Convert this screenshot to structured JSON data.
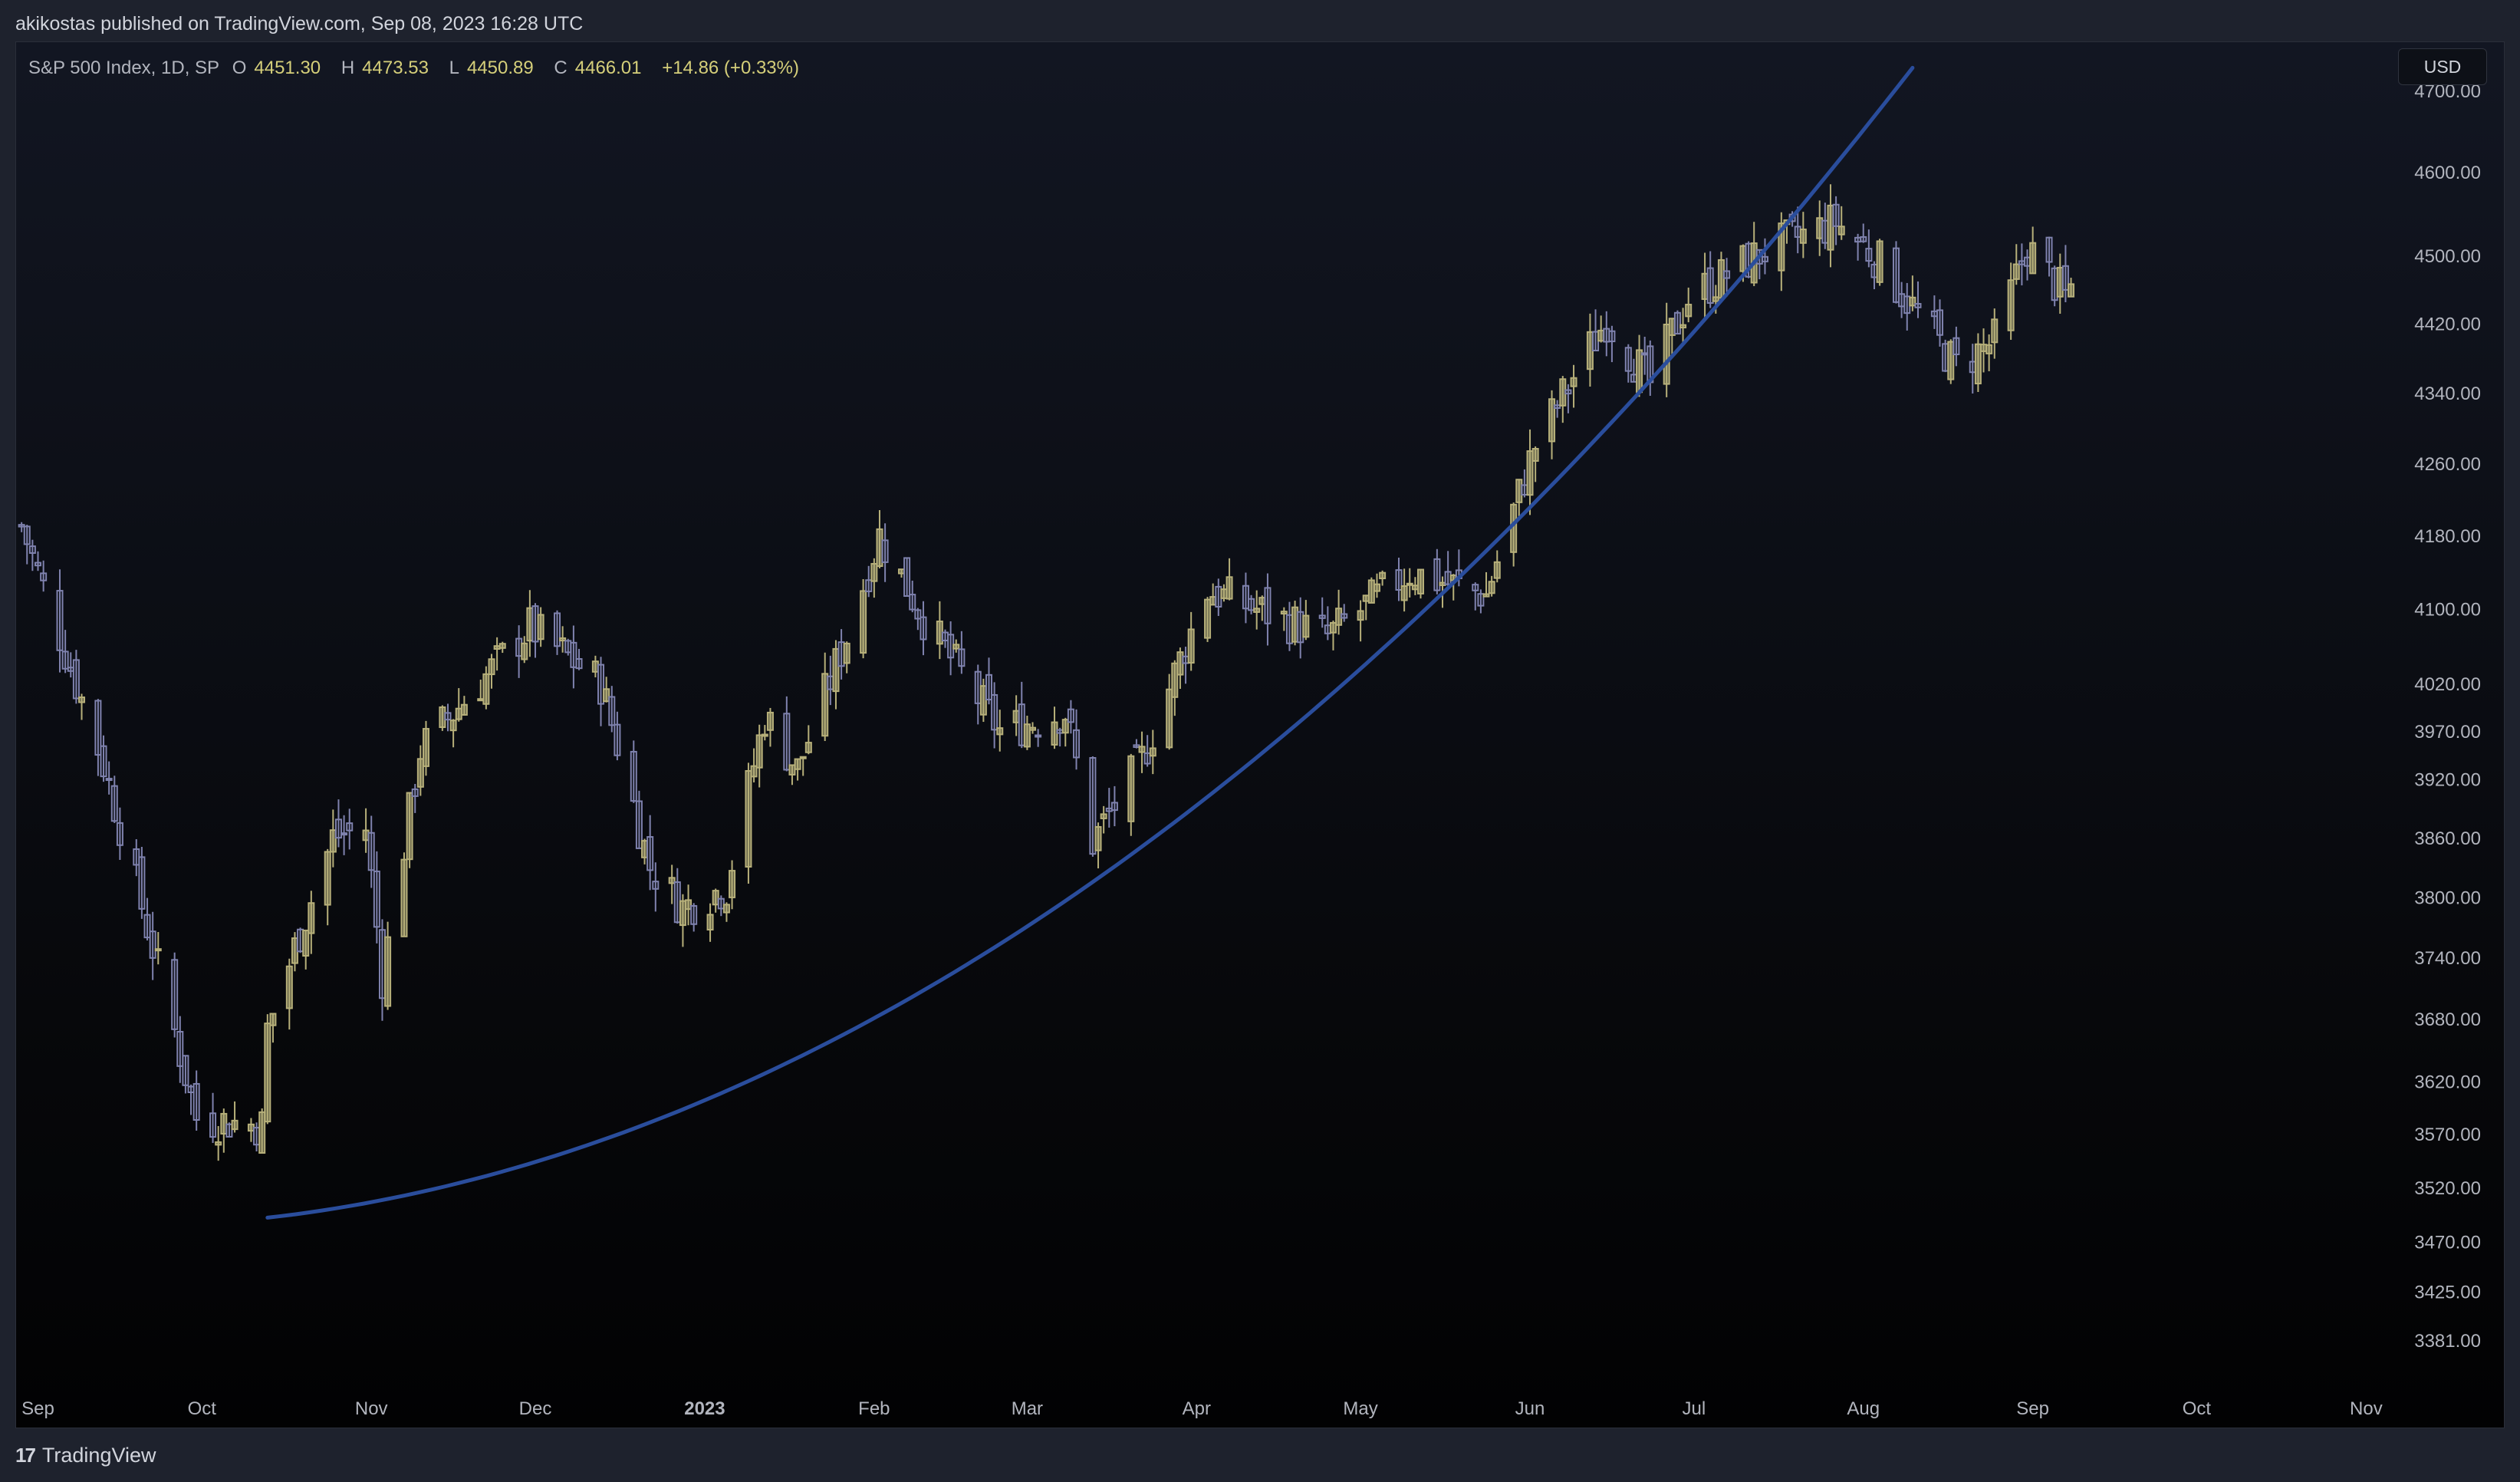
{
  "header": {
    "published_text": "akikostas published on TradingView.com, Sep 08, 2023 16:28 UTC"
  },
  "legend": {
    "symbol": "S&P 500 Index, 1D, SP",
    "open_label": "O",
    "open": "4451.30",
    "high_label": "H",
    "high": "4473.53",
    "low_label": "L",
    "low": "4450.89",
    "close_label": "C",
    "close": "4466.01",
    "change": "+14.86 (+0.33%)"
  },
  "currency": "USD",
  "footer": {
    "brand": "TradingView",
    "logo_mark": "17"
  },
  "colors": {
    "bull": "#b7b07a",
    "bear": "#7f82ae",
    "trend": "#2a4d9c",
    "axis_text": "#b2b5be"
  },
  "chart_data": {
    "type": "candlestick",
    "y_scale": "log",
    "ylim": [
      3335,
      4760
    ],
    "y_ticks": [
      4700,
      4600,
      4500,
      4420,
      4340,
      4260,
      4180,
      4100,
      4020,
      3970,
      3920,
      3860,
      3800,
      3740,
      3680,
      3620,
      3570,
      3520,
      3470,
      3425,
      3381
    ],
    "y_tick_labels": [
      "4700.00",
      "4600.00",
      "4500.00",
      "4420.00",
      "4340.00",
      "4260.00",
      "4180.00",
      "4100.00",
      "4020.00",
      "3970.00",
      "3920.00",
      "3860.00",
      "3800.00",
      "3740.00",
      "3680.00",
      "3620.00",
      "3570.00",
      "3520.00",
      "3470.00",
      "3425.00",
      "3381.00"
    ],
    "x_ticks": [
      {
        "date": "2022-09-01",
        "label": "Sep",
        "bold": false
      },
      {
        "date": "2022-10-01",
        "label": "Oct",
        "bold": false
      },
      {
        "date": "2022-11-01",
        "label": "Nov",
        "bold": false
      },
      {
        "date": "2022-12-01",
        "label": "Dec",
        "bold": false
      },
      {
        "date": "2023-01-01",
        "label": "2023",
        "bold": true
      },
      {
        "date": "2023-02-01",
        "label": "Feb",
        "bold": false
      },
      {
        "date": "2023-03-01",
        "label": "Mar",
        "bold": false
      },
      {
        "date": "2023-04-01",
        "label": "Apr",
        "bold": false
      },
      {
        "date": "2023-05-01",
        "label": "May",
        "bold": false
      },
      {
        "date": "2023-06-01",
        "label": "Jun",
        "bold": false
      },
      {
        "date": "2023-07-01",
        "label": "Jul",
        "bold": false
      },
      {
        "date": "2023-08-01",
        "label": "Aug",
        "bold": false
      },
      {
        "date": "2023-09-01",
        "label": "Sep",
        "bold": false
      },
      {
        "date": "2023-10-01",
        "label": "Oct",
        "bold": false
      },
      {
        "date": "2023-11-01",
        "label": "Nov",
        "bold": false
      }
    ],
    "x_range": [
      "2022-08-28",
      "2023-11-06"
    ],
    "close_path": [
      [
        "2022-08-29",
        4190
      ],
      [
        "2022-09-13",
        3935
      ],
      [
        "2022-09-30",
        3585
      ],
      [
        "2022-10-12",
        3578
      ],
      [
        "2022-10-13",
        3670
      ],
      [
        "2022-10-25",
        3860
      ],
      [
        "2022-10-31",
        3870
      ],
      [
        "2022-11-03",
        3720
      ],
      [
        "2022-11-10",
        3950
      ],
      [
        "2022-11-30",
        4080
      ],
      [
        "2022-12-13",
        4020
      ],
      [
        "2022-12-22",
        3830
      ],
      [
        "2022-12-28",
        3790
      ],
      [
        "2023-01-05",
        3810
      ],
      [
        "2023-01-12",
        3985
      ],
      [
        "2023-01-18",
        3930
      ],
      [
        "2023-01-27",
        4070
      ],
      [
        "2023-02-02",
        4180
      ],
      [
        "2023-02-10",
        4090
      ],
      [
        "2023-02-24",
        3970
      ],
      [
        "2023-03-08",
        3990
      ],
      [
        "2023-03-13",
        3855
      ],
      [
        "2023-03-22",
        3940
      ],
      [
        "2023-04-03",
        4120
      ],
      [
        "2023-04-25",
        4070
      ],
      [
        "2023-05-10",
        4140
      ],
      [
        "2023-05-24",
        4115
      ],
      [
        "2023-06-02",
        4280
      ],
      [
        "2023-06-15",
        4425
      ],
      [
        "2023-06-23",
        4350
      ],
      [
        "2023-06-30",
        4450
      ],
      [
        "2023-07-14",
        4505
      ],
      [
        "2023-07-27",
        4540
      ],
      [
        "2023-08-03",
        4500
      ],
      [
        "2023-08-18",
        4370
      ],
      [
        "2023-08-25",
        4400
      ],
      [
        "2023-08-31",
        4510
      ],
      [
        "2023-09-07",
        4451
      ],
      [
        "2023-09-08",
        4466
      ]
    ],
    "last_candle": {
      "date": "2023-09-08",
      "open": 4451.3,
      "high": 4473.53,
      "low": 4450.89,
      "close": 4466.01
    },
    "trendline": {
      "type": "exponential",
      "points": [
        [
          "2022-10-13",
          3492
        ],
        [
          "2023-03-13",
          3815
        ],
        [
          "2023-08-10",
          4728
        ]
      ]
    }
  }
}
